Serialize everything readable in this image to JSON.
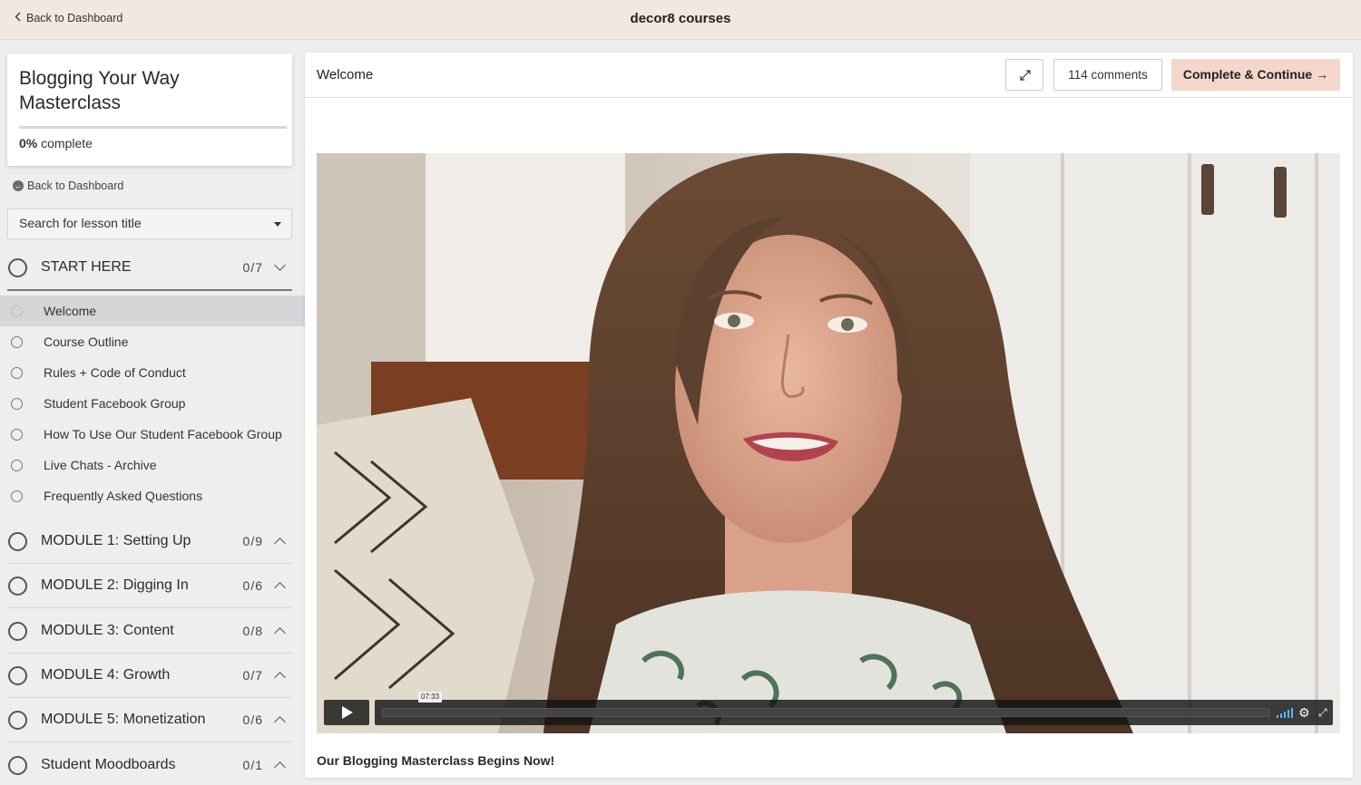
{
  "topbar": {
    "back_label": "Back to Dashboard",
    "brand": "decor8 courses"
  },
  "sidebar": {
    "course_title": "Blogging Your Way Masterclass",
    "progress_percent": 0,
    "progress_value": "0%",
    "progress_suffix": " complete",
    "back_label": "Back to Dashboard",
    "search_placeholder": "Search for lesson title",
    "sections": [
      {
        "name": "START HERE",
        "count": "0/7",
        "expanded": true,
        "lessons": [
          {
            "label": "Welcome",
            "active": true
          },
          {
            "label": "Course Outline",
            "active": false
          },
          {
            "label": "Rules + Code of Conduct",
            "active": false
          },
          {
            "label": "Student Facebook Group",
            "active": false
          },
          {
            "label": "How To Use Our Student Facebook Group",
            "active": false
          },
          {
            "label": "Live Chats - Archive",
            "active": false
          },
          {
            "label": "Frequently Asked Questions",
            "active": false
          }
        ]
      },
      {
        "name": "MODULE 1: Setting Up",
        "count": "0/9",
        "expanded": false
      },
      {
        "name": "MODULE 2: Digging In",
        "count": "0/6",
        "expanded": false
      },
      {
        "name": "MODULE 3: Content",
        "count": "0/8",
        "expanded": false
      },
      {
        "name": "MODULE 4: Growth",
        "count": "0/7",
        "expanded": false
      },
      {
        "name": "MODULE 5: Monetization",
        "count": "0/6",
        "expanded": false
      },
      {
        "name": "Student Moodboards",
        "count": "0/1",
        "expanded": false
      }
    ]
  },
  "main": {
    "lesson_title": "Welcome",
    "comments_label": "114 comments",
    "complete_label": "Complete & Continue →",
    "video_caption": "Our Blogging Masterclass Begins Now!",
    "video_timecode": "07:33",
    "video_progress": 0
  },
  "colors": {
    "topbar_bg": "#f1e8df",
    "complete_button": "#f5d6cb",
    "active_lesson_bg": "#d6d6d9"
  }
}
